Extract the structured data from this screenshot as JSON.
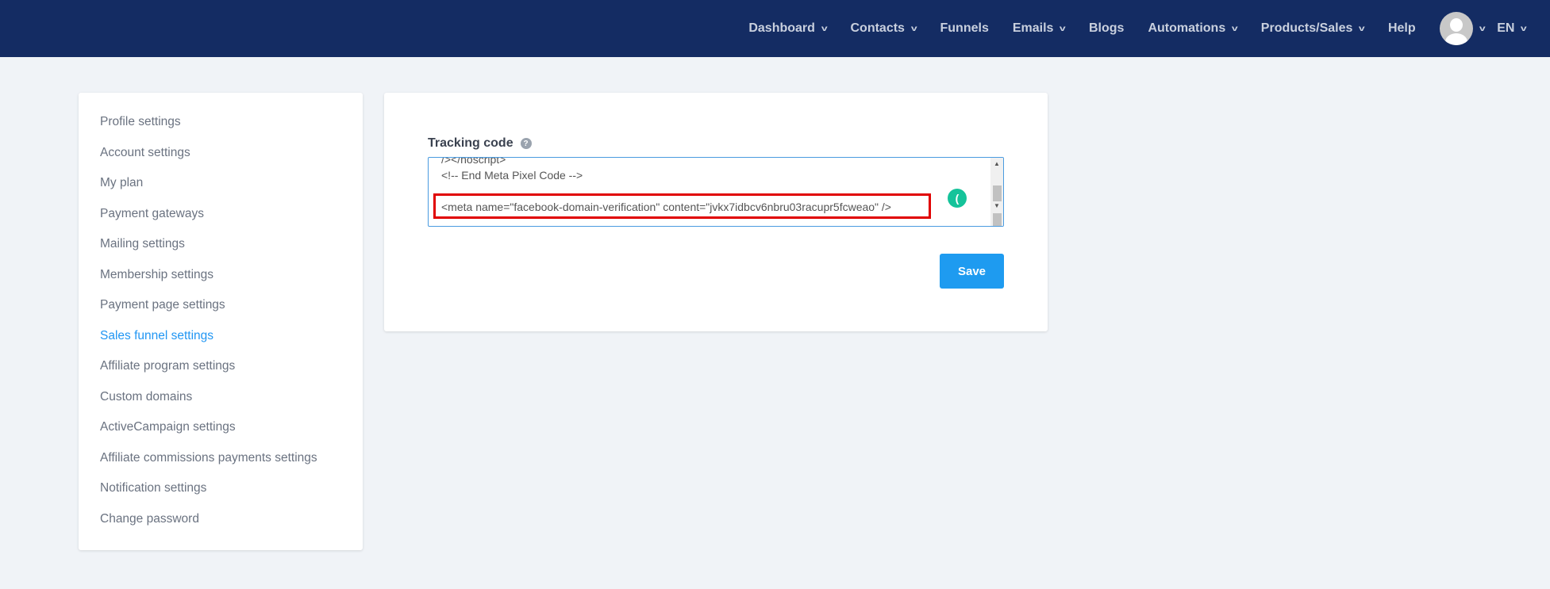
{
  "nav": {
    "items": [
      {
        "label": "Dashboard",
        "dropdown": true
      },
      {
        "label": "Contacts",
        "dropdown": true
      },
      {
        "label": "Funnels",
        "dropdown": false
      },
      {
        "label": "Emails",
        "dropdown": true
      },
      {
        "label": "Blogs",
        "dropdown": false
      },
      {
        "label": "Automations",
        "dropdown": true
      },
      {
        "label": "Products/Sales",
        "dropdown": true
      },
      {
        "label": "Help",
        "dropdown": false
      }
    ],
    "language": "EN"
  },
  "sidebar": {
    "active": "Sales funnel settings",
    "items": [
      "Profile settings",
      "Account settings",
      "My plan",
      "Payment gateways",
      "Mailing settings",
      "Membership settings",
      "Payment page settings",
      "Sales funnel settings",
      "Affiliate program settings",
      "Custom domains",
      "ActiveCampaign settings",
      "Affiliate commissions payments settings",
      "Notification settings",
      "Change password"
    ]
  },
  "main": {
    "tracking_label": "Tracking code",
    "help_icon": "?",
    "code_lines": [
      "/></noscript>",
      "<!-- End Meta Pixel Code -->",
      "",
      "<meta name=\"facebook-domain-verification\" content=\"jvkx7idbcv6nbru03racupr5fcweao\" />"
    ],
    "save_label": "Save"
  },
  "colors": {
    "nav": "#142c63",
    "accent": "#1e9bf0",
    "highlight": "#e00000"
  }
}
